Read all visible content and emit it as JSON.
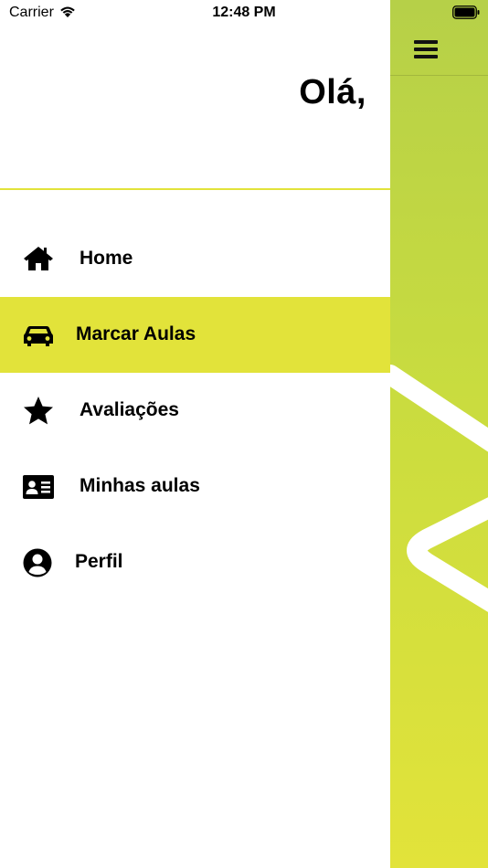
{
  "status_bar": {
    "carrier": "Carrier",
    "time": "12:48 PM"
  },
  "drawer": {
    "greeting": "Olá,",
    "items": [
      {
        "label": "Home",
        "icon": "home-icon"
      },
      {
        "label": "Marcar Aulas",
        "icon": "car-icon",
        "active": true
      },
      {
        "label": "Avaliações",
        "icon": "star-icon"
      },
      {
        "label": "Minhas aulas",
        "icon": "id-card-icon"
      },
      {
        "label": "Perfil",
        "icon": "user-circle-icon"
      }
    ]
  },
  "colors": {
    "accent": "#e2e33a",
    "panel_top": "#b6d048",
    "panel_bottom": "#e2e33a",
    "text": "#000000"
  }
}
